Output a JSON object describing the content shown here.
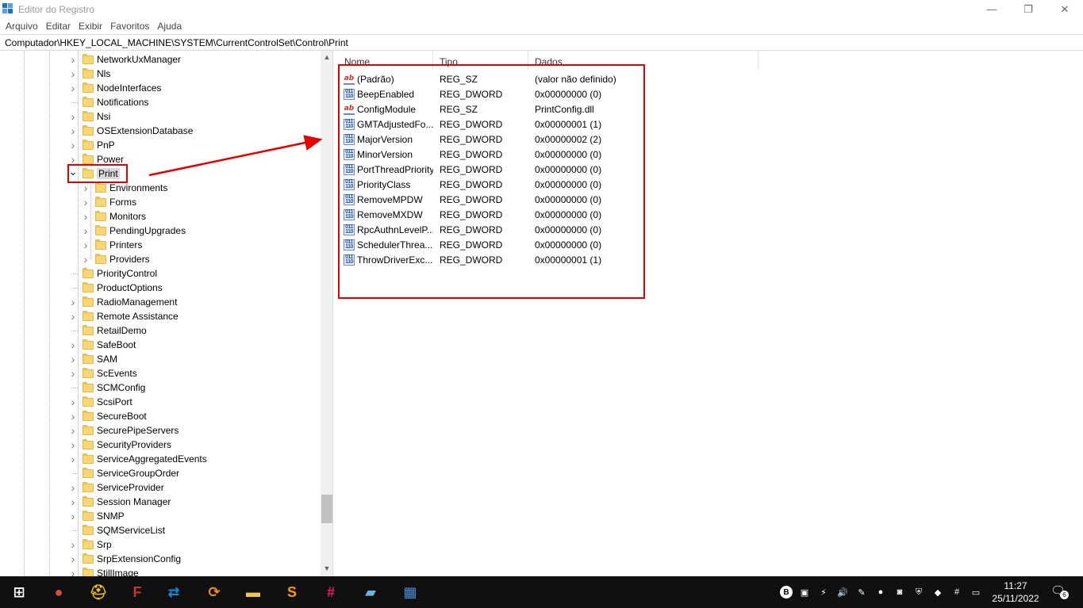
{
  "window": {
    "title": "Editor do Registro",
    "controls": {
      "minimize": "—",
      "maximize": "❐",
      "close": "✕"
    }
  },
  "menu": [
    "Arquivo",
    "Editar",
    "Exibir",
    "Favoritos",
    "Ajuda"
  ],
  "address": "Computador\\HKEY_LOCAL_MACHINE\\SYSTEM\\CurrentControlSet\\Control\\Print",
  "tree": {
    "items": [
      {
        "label": "NetworkUxManager",
        "expandable": true
      },
      {
        "label": "Nls",
        "expandable": true
      },
      {
        "label": "NodeInterfaces",
        "expandable": true
      },
      {
        "label": "Notifications",
        "expandable": false
      },
      {
        "label": "Nsi",
        "expandable": true
      },
      {
        "label": "OSExtensionDatabase",
        "expandable": true
      },
      {
        "label": "PnP",
        "expandable": true
      },
      {
        "label": "Power",
        "expandable": true
      },
      {
        "label": "Print",
        "expandable": true,
        "expanded": true,
        "selected": true
      },
      {
        "label": "Environments",
        "expandable": true,
        "child": true
      },
      {
        "label": "Forms",
        "expandable": true,
        "child": true
      },
      {
        "label": "Monitors",
        "expandable": true,
        "child": true
      },
      {
        "label": "PendingUpgrades",
        "expandable": true,
        "child": true
      },
      {
        "label": "Printers",
        "expandable": true,
        "child": true
      },
      {
        "label": "Providers",
        "expandable": true,
        "child": true
      },
      {
        "label": "PriorityControl",
        "expandable": false
      },
      {
        "label": "ProductOptions",
        "expandable": false
      },
      {
        "label": "RadioManagement",
        "expandable": true
      },
      {
        "label": "Remote Assistance",
        "expandable": true
      },
      {
        "label": "RetailDemo",
        "expandable": false
      },
      {
        "label": "SafeBoot",
        "expandable": true
      },
      {
        "label": "SAM",
        "expandable": true
      },
      {
        "label": "ScEvents",
        "expandable": true
      },
      {
        "label": "SCMConfig",
        "expandable": false
      },
      {
        "label": "ScsiPort",
        "expandable": true
      },
      {
        "label": "SecureBoot",
        "expandable": true
      },
      {
        "label": "SecurePipeServers",
        "expandable": true
      },
      {
        "label": "SecurityProviders",
        "expandable": true
      },
      {
        "label": "ServiceAggregatedEvents",
        "expandable": true
      },
      {
        "label": "ServiceGroupOrder",
        "expandable": false
      },
      {
        "label": "ServiceProvider",
        "expandable": true
      },
      {
        "label": "Session Manager",
        "expandable": true
      },
      {
        "label": "SNMP",
        "expandable": true
      },
      {
        "label": "SQMServiceList",
        "expandable": false
      },
      {
        "label": "Srp",
        "expandable": true
      },
      {
        "label": "SrpExtensionConfig",
        "expandable": true
      },
      {
        "label": "StillImage",
        "expandable": true
      }
    ]
  },
  "list": {
    "headers": [
      "Nome",
      "Tipo",
      "Dados"
    ],
    "rows": [
      {
        "name": "(Padrão)",
        "type": "REG_SZ",
        "data": "(valor não definido)",
        "icon": "string-value-icon"
      },
      {
        "name": "BeepEnabled",
        "type": "REG_DWORD",
        "data": "0x00000000 (0)",
        "icon": "dword-value-icon"
      },
      {
        "name": "ConfigModule",
        "type": "REG_SZ",
        "data": "PrintConfig.dll",
        "icon": "string-value-icon"
      },
      {
        "name": "GMTAdjustedFo...",
        "type": "REG_DWORD",
        "data": "0x00000001 (1)",
        "icon": "dword-value-icon"
      },
      {
        "name": "MajorVersion",
        "type": "REG_DWORD",
        "data": "0x00000002 (2)",
        "icon": "dword-value-icon"
      },
      {
        "name": "MinorVersion",
        "type": "REG_DWORD",
        "data": "0x00000000 (0)",
        "icon": "dword-value-icon"
      },
      {
        "name": "PortThreadPriority",
        "type": "REG_DWORD",
        "data": "0x00000000 (0)",
        "icon": "dword-value-icon"
      },
      {
        "name": "PriorityClass",
        "type": "REG_DWORD",
        "data": "0x00000000 (0)",
        "icon": "dword-value-icon"
      },
      {
        "name": "RemoveMPDW",
        "type": "REG_DWORD",
        "data": "0x00000000 (0)",
        "icon": "dword-value-icon"
      },
      {
        "name": "RemoveMXDW",
        "type": "REG_DWORD",
        "data": "0x00000000 (0)",
        "icon": "dword-value-icon"
      },
      {
        "name": "RpcAuthnLevelP...",
        "type": "REG_DWORD",
        "data": "0x00000000 (0)",
        "icon": "dword-value-icon"
      },
      {
        "name": "SchedulerThrea...",
        "type": "REG_DWORD",
        "data": "0x00000000 (0)",
        "icon": "dword-value-icon"
      },
      {
        "name": "ThrowDriverExc...",
        "type": "REG_DWORD",
        "data": "0x00000001 (1)",
        "icon": "dword-value-icon"
      }
    ]
  },
  "icon_glyphs": {
    "string": "ab",
    "dword": "011\n110"
  },
  "taskbar": {
    "apps": [
      {
        "name": "start-icon",
        "glyph": "⊞",
        "color": "#ffffff"
      },
      {
        "name": "chrome-icon",
        "glyph": "●",
        "color": "#dd4b39"
      },
      {
        "name": "helmet-app-icon",
        "glyph": "⛑",
        "color": "#f5c518"
      },
      {
        "name": "flamerobin-icon",
        "glyph": "F",
        "color": "#c0392b"
      },
      {
        "name": "teamviewer-icon",
        "glyph": "⇄",
        "color": "#0e8ee9"
      },
      {
        "name": "sync-icon",
        "glyph": "⟳",
        "color": "#f08a24"
      },
      {
        "name": "file-explorer-icon",
        "glyph": "▬",
        "color": "#f3c546"
      },
      {
        "name": "sublime-text-icon",
        "glyph": "S",
        "color": "#ff9800"
      },
      {
        "name": "slack-icon",
        "glyph": "#",
        "color": "#e01e5a"
      },
      {
        "name": "notepad-app-icon",
        "glyph": "▰",
        "color": "#6fb3e0"
      },
      {
        "name": "regedit-icon",
        "glyph": "▦",
        "color": "#4a90d9"
      }
    ],
    "tray": [
      {
        "name": "b-tray-icon",
        "glyph": "B"
      },
      {
        "name": "network-device-tray-icon",
        "glyph": "▣"
      },
      {
        "name": "power-tray-icon",
        "glyph": "⚡"
      },
      {
        "name": "volume-tray-icon",
        "glyph": "🔊"
      },
      {
        "name": "pen-tray-icon",
        "glyph": "✎"
      },
      {
        "name": "orange-app-tray-icon",
        "glyph": "●"
      },
      {
        "name": "monitor-tray-icon",
        "glyph": "◙"
      },
      {
        "name": "shield-tray-icon",
        "glyph": "⛨"
      },
      {
        "name": "anydesk-tray-icon",
        "glyph": "◆"
      },
      {
        "name": "slack-tray-icon",
        "glyph": "#"
      },
      {
        "name": "display-tray-icon",
        "glyph": "▭"
      }
    ],
    "time": "11:27",
    "date": "25/11/2022",
    "notification_count": "6"
  }
}
